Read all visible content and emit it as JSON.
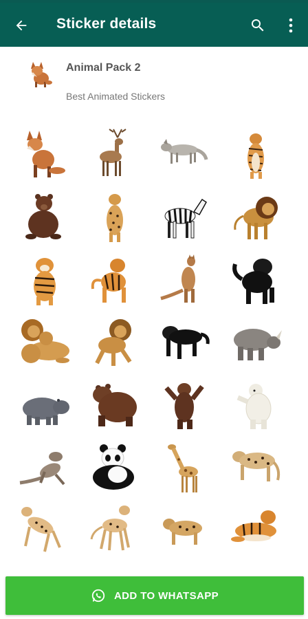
{
  "app_bar": {
    "title": "Sticker details",
    "color": "#075e54",
    "icons": [
      "arrow-back-icon",
      "search-icon",
      "more-vert-icon"
    ]
  },
  "pack": {
    "name": "Animal Pack 2",
    "publisher": "Best Animated Stickers",
    "tray_icon": "fox-icon"
  },
  "stickers": [
    "fox",
    "deer",
    "wolf",
    "tiger",
    "brown-bear",
    "leopard",
    "zebra",
    "lion",
    "tiger",
    "tiger",
    "kangaroo",
    "black-panther",
    "lions",
    "lion",
    "black-panther",
    "rhinoceros",
    "hippopotamus",
    "brown-bear",
    "standing-bear",
    "polar-bear",
    "lizard",
    "panda",
    "giraffe",
    "leopard",
    "cheetah",
    "cheetah",
    "leopard",
    "tiger"
  ],
  "action": {
    "label": "ADD TO WHATSAPP",
    "color": "#3fbe3a",
    "icon": "whatsapp-icon"
  }
}
